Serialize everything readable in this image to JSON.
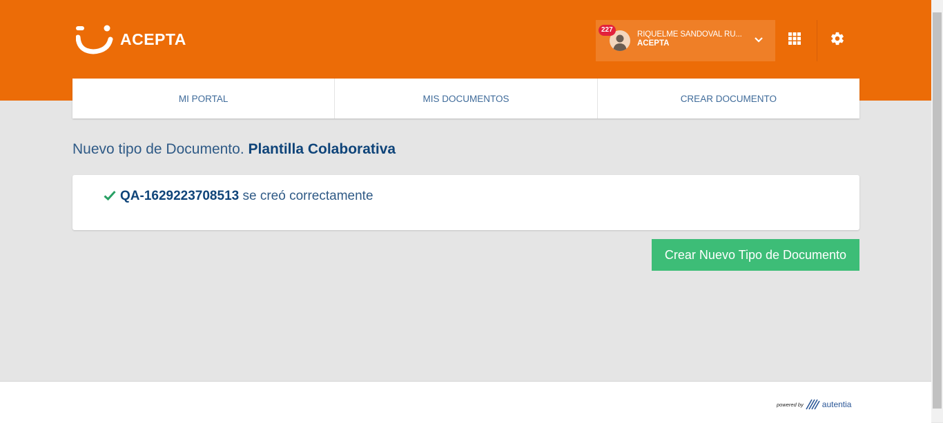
{
  "header": {
    "logo_text": "ACEPTA",
    "user": {
      "name": "RIQUELME SANDOVAL RU...",
      "organization": "ACEPTA",
      "notification_count": "227"
    },
    "icons": {
      "logo": "acepta-smile-logo",
      "user_menu": "chevron-down-icon",
      "apps": "apps-grid-icon",
      "settings": "gear-icon"
    }
  },
  "nav": {
    "tabs": [
      {
        "label": "MI PORTAL"
      },
      {
        "label": "MIS DOCUMENTOS"
      },
      {
        "label": "CREAR DOCUMENTO"
      }
    ]
  },
  "main": {
    "heading_prefix": "Nuevo tipo de Documento.",
    "heading_strong": "Plantilla Colaborativa",
    "success": {
      "code": "QA-1629223708513",
      "text": "se creó correctamente"
    },
    "new_button_label": "Crear Nuevo Tipo de Documento"
  },
  "footer": {
    "powered_by": "powered by",
    "brand": "autentia"
  },
  "colors": {
    "brand_orange": "#ec6c07",
    "primary_blue": "#0f4479",
    "success_green": "#3dbd77",
    "badge_red": "#e2213c"
  }
}
